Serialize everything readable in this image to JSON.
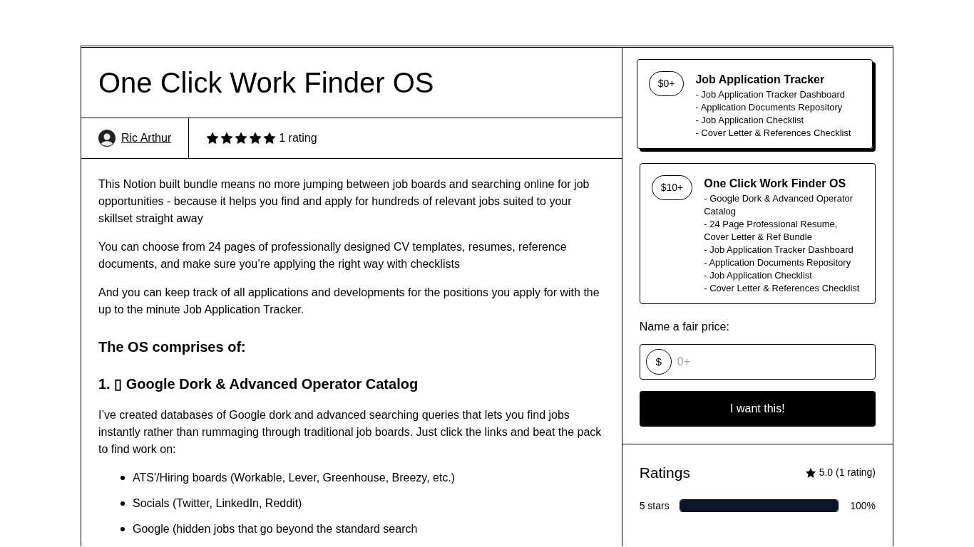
{
  "product": {
    "title": "One Click Work Finder OS",
    "author": "Ric Arthur",
    "stars": 5,
    "rating_count": "1 rating"
  },
  "description": {
    "paragraphs": [
      "This Notion built bundle means no more jumping between job boards and searching online for job opportunities -  because it helps you find and apply for hundreds of relevant jobs suited to your skillset straight away",
      "You can choose from 24 pages of professionally designed CV templates, resumes, reference documents, and make sure you’re applying the right way with checklists",
      "And  you can keep track of all applications and developments for the positions you apply for with the up to the minute Job Application Tracker."
    ],
    "heading": "The OS comprises of:",
    "section_heading": "1. ▯ Google Dork & Advanced Operator Catalog",
    "section_text": "I’ve created databases of Google dork and advanced searching queries that lets you find jobs instantly rather than rummaging through traditional job boards. Just click the links and beat the pack to find work on:",
    "bullets": [
      "ATS'/Hiring boards (Workable, Lever, Greenhouse, Breezy, etc.)",
      "Socials (Twitter, LinkedIn, Reddit)",
      "Google (hidden jobs that go beyond the standard search"
    ]
  },
  "tiers": [
    {
      "price": "$0+",
      "name": "Job Application Tracker",
      "selected": true,
      "lines": [
        "- Job Application Tracker Dashboard",
        "- Application Documents Repository",
        "- Job Application Checklist",
        "- Cover Letter & References Checklist"
      ]
    },
    {
      "price": "$10+",
      "name": "One Click Work Finder OS",
      "selected": false,
      "lines": [
        "- Google Dork & Advanced Operator Catalog",
        "- 24 Page Professional Resume, Cover Letter & Ref Bundle",
        "- Job Application Tracker Dashboard",
        "- Application Documents Repository",
        "- Job Application Checklist",
        "- Cover Letter & References Checklist"
      ]
    }
  ],
  "price_field": {
    "label": "Name a fair price:",
    "currency": "$",
    "placeholder": "0+"
  },
  "buy_button": "I want this!",
  "ratings": {
    "title": "Ratings",
    "summary": "5.0 (1 rating)",
    "rows": [
      {
        "label": "5 stars",
        "level": 1,
        "percent": "100%"
      }
    ]
  }
}
